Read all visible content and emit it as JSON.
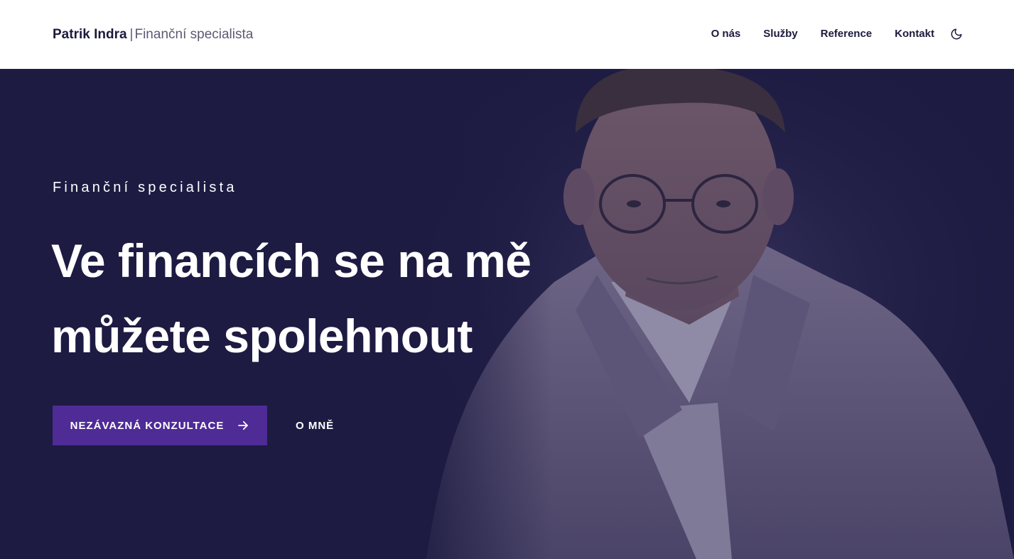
{
  "header": {
    "brand_name": "Patrik Indra",
    "brand_separator": "|",
    "brand_role": "Finanční specialista",
    "nav": [
      {
        "label": "O nás"
      },
      {
        "label": "Služby"
      },
      {
        "label": "Reference"
      },
      {
        "label": "Kontakt"
      }
    ],
    "theme_toggle_icon": "moon-icon"
  },
  "hero": {
    "eyebrow": "Finanční specialista",
    "headline": "Ve financích se na mě můžete spolehnout",
    "primary_button": {
      "label": "NEZÁVAZNÁ KONZULTACE",
      "icon": "arrow-right-icon"
    },
    "secondary_link": {
      "label": "O MNĚ"
    },
    "portrait_alt": "portrait-photo"
  },
  "colors": {
    "header_bg": "#ffffff",
    "brand_text": "#1c1a3c",
    "hero_bg": "#1d1b42",
    "accent": "#4f2b96",
    "hero_text": "#ffffff"
  }
}
